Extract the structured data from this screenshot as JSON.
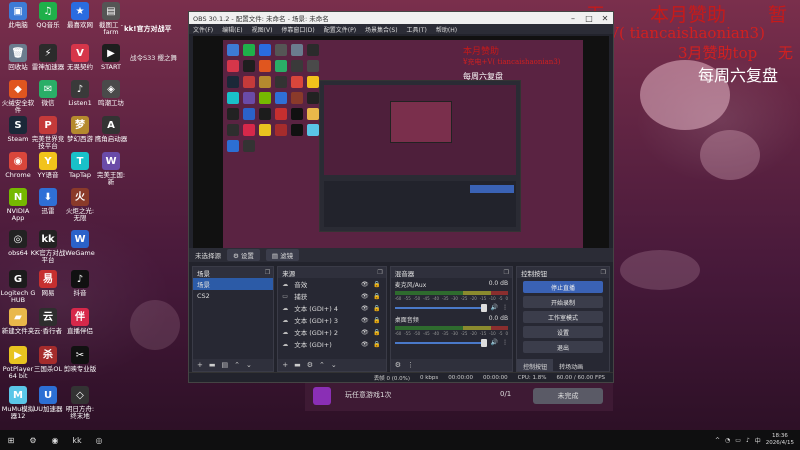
{
  "overlay": {
    "line1_a": "无",
    "line1_b": "本月赞助",
    "line1_c": "暂",
    "line2": "¥充电+V( tiancaishaonian3)",
    "line3": "3月赞助top",
    "line3_b": "无",
    "line4": "每周六复盘"
  },
  "desktop_icons": [
    {
      "label": "此电脑",
      "color": "#3d7bd6",
      "glyph": "▣"
    },
    {
      "label": "QQ音乐",
      "color": "#1fb04a",
      "glyph": "♫"
    },
    {
      "label": "最喜欢网",
      "color": "#2a6ce0",
      "glyph": "★"
    },
    {
      "label": "截图工 - farm",
      "color": "#555",
      "glyph": "▤"
    },
    {
      "label": "回收站",
      "color": "#6b7c8e",
      "glyph": "🗑"
    },
    {
      "label": "雷神加速器",
      "color": "#2b2b2b",
      "glyph": "⚡"
    },
    {
      "label": "无畏契约",
      "color": "#d6364a",
      "glyph": "V"
    },
    {
      "label": "START",
      "color": "#1e1e1e",
      "glyph": "▶"
    },
    {
      "label": "火绒安全软件",
      "color": "#e0561f",
      "glyph": "◆"
    },
    {
      "label": "微信",
      "color": "#2aae67",
      "glyph": "✉"
    },
    {
      "label": "Listen1",
      "color": "#3a3a3a",
      "glyph": "♪"
    },
    {
      "label": "鸣潮工坊",
      "color": "#4a4a4a",
      "glyph": "◈"
    },
    {
      "label": "Steam",
      "color": "#1b2838",
      "glyph": "S"
    },
    {
      "label": "完美世界竞技平台",
      "color": "#c43a3a",
      "glyph": "P"
    },
    {
      "label": "梦幻西游",
      "color": "#b58a2e",
      "glyph": "梦"
    },
    {
      "label": "鹰角启动器",
      "color": "#333",
      "glyph": "A"
    },
    {
      "label": "Chrome",
      "color": "#d9463b",
      "glyph": "◉"
    },
    {
      "label": "YY语音",
      "color": "#f2c31b",
      "glyph": "Y"
    },
    {
      "label": "TapTap",
      "color": "#19c1c9",
      "glyph": "T"
    },
    {
      "label": "完美王国: 新",
      "color": "#6a4ba8",
      "glyph": "W"
    },
    {
      "label": "NVIDIA App",
      "color": "#76b900",
      "glyph": "N"
    },
    {
      "label": "迅雷",
      "color": "#2f6fd6",
      "glyph": "⬇"
    },
    {
      "label": "火炬之光: 无限",
      "color": "#8a3a2a",
      "glyph": "火"
    },
    {
      "label": "obs64",
      "color": "#222",
      "glyph": "◎"
    },
    {
      "label": "KK官方对战平台",
      "color": "#222",
      "glyph": "kk"
    },
    {
      "label": "WeGame",
      "color": "#2b62c9",
      "glyph": "W"
    },
    {
      "label": "Logitech G HUB",
      "color": "#1c1c1c",
      "glyph": "G"
    },
    {
      "label": "网易",
      "color": "#c62f2f",
      "glyph": "易"
    },
    {
      "label": "抖音",
      "color": "#111",
      "glyph": "♪"
    },
    {
      "label": "新建文件夹",
      "color": "#e9b84a",
      "glyph": "▰"
    },
    {
      "label": "云·香行者",
      "color": "#2e2e2e",
      "glyph": "云"
    },
    {
      "label": "直播伴侣",
      "color": "#d6284a",
      "glyph": "伴"
    },
    {
      "label": "PotPlayer 64 bit",
      "color": "#e8c420",
      "glyph": "▶"
    },
    {
      "label": "三国杀OL",
      "color": "#a52c2c",
      "glyph": "杀"
    },
    {
      "label": "剪映专业版",
      "color": "#111",
      "glyph": "✂"
    },
    {
      "label": "MuMu模拟器12",
      "color": "#5ac6e8",
      "glyph": "M"
    },
    {
      "label": "UU加速器",
      "color": "#2c6fd4",
      "glyph": "U"
    },
    {
      "label": "明日方舟: 终末地",
      "color": "#333",
      "glyph": "◇"
    }
  ],
  "launcher": {
    "brand": "kk!官方对战平",
    "subtitle": "战令S33 樱之舞"
  },
  "obs": {
    "title": "OBS 30.1.2 - 配置文件: 未命名 - 场景: 未命名",
    "window_controls": [
      "–",
      "□",
      "✕"
    ],
    "menu": [
      "文件(F)",
      "编辑(E)",
      "视图(V)",
      "停靠窗口(D)",
      "配置文件(P)",
      "场景集合(S)",
      "工具(T)",
      "帮助(H)"
    ],
    "toolbar": {
      "no_source": "未选择源",
      "properties": "⚙ 设置",
      "filters": "▤ 滤镜"
    },
    "scenes": {
      "title": "场景",
      "items": [
        "场景",
        "CS2"
      ]
    },
    "sources": {
      "title": "来源",
      "items": [
        {
          "icon": "☁",
          "name": "音效"
        },
        {
          "icon": "▭",
          "name": "捕获"
        },
        {
          "icon": "☁",
          "name": "文本 (GDI+) 4"
        },
        {
          "icon": "☁",
          "name": "文本 (GDI+) 3"
        },
        {
          "icon": "☁",
          "name": "文本 (GDI+) 2"
        },
        {
          "icon": "☁",
          "name": "文本 (GDI+)"
        }
      ]
    },
    "mixer": {
      "title": "混音器",
      "tracks": [
        {
          "name": "麦克风/Aux",
          "db": "0.0 dB"
        },
        {
          "name": "桌面音频",
          "db": "0.0 dB"
        }
      ],
      "scale": [
        "-60",
        "-55",
        "-50",
        "-45",
        "-40",
        "-35",
        "-30",
        "-25",
        "-20",
        "-15",
        "-10",
        "-5",
        "0"
      ]
    },
    "controls": {
      "title": "控制按钮",
      "buttons": [
        "停止直播",
        "开始录制",
        "工作室模式",
        "设置",
        "退出"
      ],
      "tabs": [
        "控制按钮",
        "转场动画"
      ]
    },
    "status": {
      "dropped": "丢帧 0 (0.0%)",
      "bitrate": "0 kbps",
      "live_time": "00:00:00",
      "rec_time": "00:00:00",
      "cpu": "CPU: 1.8%",
      "fps": "60.00 / 60.00 FPS"
    },
    "dock_glyph": "❐"
  },
  "notification": {
    "text": "玩任意游戏1次",
    "count": "0/1",
    "button": "未完成"
  },
  "taskbar": {
    "items": [
      "⊞",
      "⚙",
      "◉",
      "kk",
      "◎"
    ],
    "tray_icons": [
      "^",
      "◔",
      "▭",
      "♪",
      "中"
    ],
    "time": "18:36",
    "date": "2026/4/15"
  }
}
